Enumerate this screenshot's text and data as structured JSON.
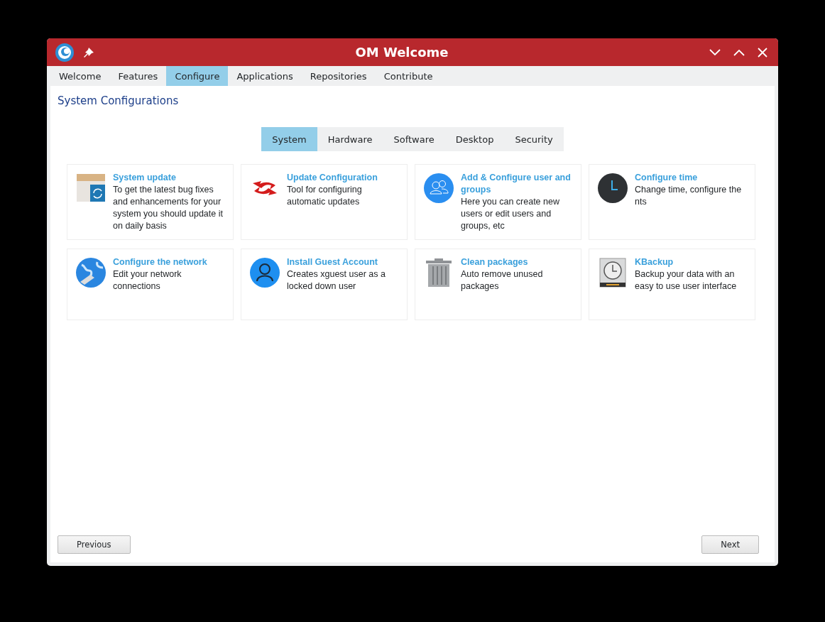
{
  "window": {
    "title": "OM Welcome"
  },
  "tabs": [
    {
      "label": "Welcome",
      "selected": false
    },
    {
      "label": "Features",
      "selected": false
    },
    {
      "label": "Configure",
      "selected": true
    },
    {
      "label": "Applications",
      "selected": false
    },
    {
      "label": "Repositories",
      "selected": false
    },
    {
      "label": "Contribute",
      "selected": false
    }
  ],
  "page_title": "System Configurations",
  "subtabs": [
    {
      "label": "System",
      "selected": true
    },
    {
      "label": "Hardware",
      "selected": false
    },
    {
      "label": "Software",
      "selected": false
    },
    {
      "label": "Desktop",
      "selected": false
    },
    {
      "label": "Security",
      "selected": false
    }
  ],
  "cards": [
    {
      "kind": "package",
      "title": "System update",
      "description": "To get the latest bug fixes and enhancements for your system you should update it on daily basis"
    },
    {
      "kind": "sync",
      "title": "Update Configuration",
      "description": "Tool for configuring automatic updates"
    },
    {
      "kind": "users",
      "title": "Add & Configure user and groups",
      "description": "Here you can create new users or edit users and groups, etc"
    },
    {
      "kind": "clock",
      "title": "Configure time",
      "description": "Change time, configure the nts"
    },
    {
      "kind": "globe",
      "title": "Configure the network",
      "description": "Edit your network connections"
    },
    {
      "kind": "user",
      "title": "Install Guest Account",
      "description": "Creates xguest user as a locked down user"
    },
    {
      "kind": "trash",
      "title": "Clean packages",
      "description": "Auto remove unused packages"
    },
    {
      "kind": "backup",
      "title": "KBackup",
      "description": "Backup your data with an easy to use user interface"
    }
  ],
  "buttons": {
    "previous": "Previous",
    "next": "Next"
  }
}
